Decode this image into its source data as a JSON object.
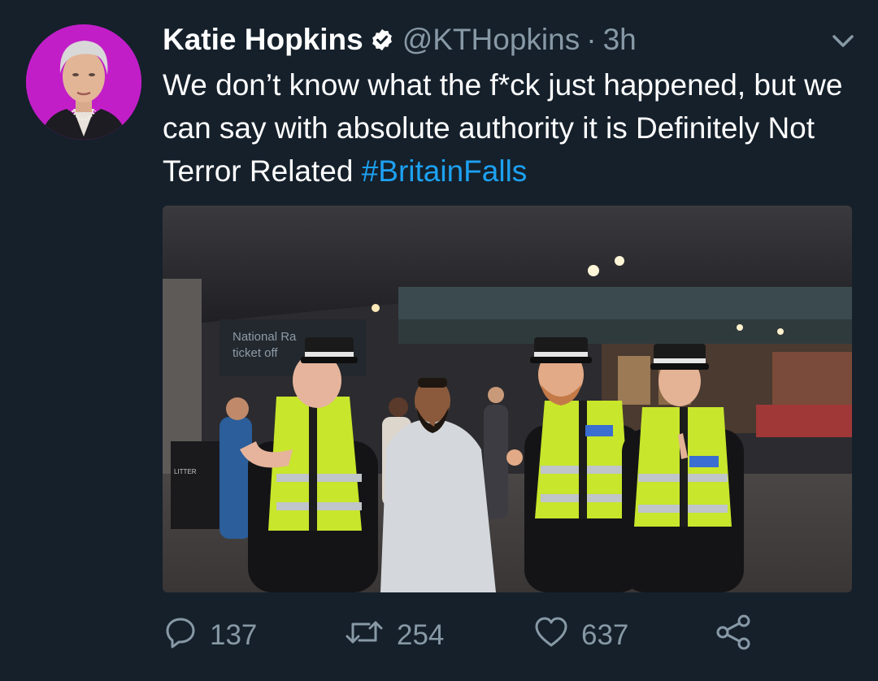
{
  "tweet": {
    "name": "Katie Hopkins",
    "handle": "@KTHopkins",
    "separator": "·",
    "time": "3h",
    "text": "We don’t know what the f*ck just happened, but we can say with absolute authority it is Definitely Not Terror Related",
    "hashtag": "#BritainFalls",
    "media_signs": {
      "sign_line1": "National Ra",
      "sign_line2": "ticket off",
      "bin_label": "LITTER"
    },
    "actions": {
      "reply_count": "137",
      "retweet_count": "254",
      "like_count": "637"
    }
  },
  "colors": {
    "background": "#15202b",
    "text": "#ffffff",
    "secondary": "#8899a6",
    "link": "#1da1f2",
    "avatar_bg": "#c21ec8",
    "hi_vis": "#c8e62b"
  },
  "icons": [
    "verified-badge-icon",
    "chevron-down-icon",
    "reply-icon",
    "retweet-icon",
    "like-icon",
    "share-icon"
  ]
}
